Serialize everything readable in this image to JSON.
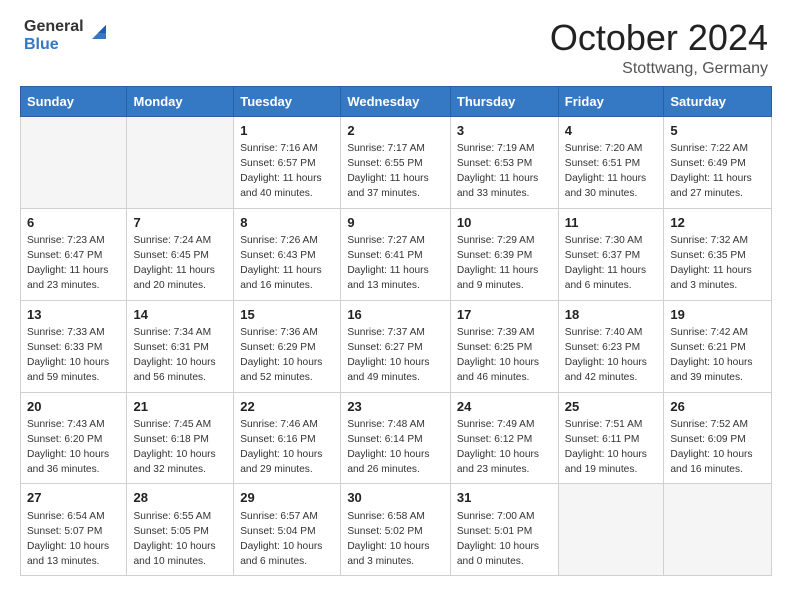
{
  "header": {
    "logo_line1": "General",
    "logo_line2": "Blue",
    "month": "October 2024",
    "location": "Stottwang, Germany"
  },
  "days_of_week": [
    "Sunday",
    "Monday",
    "Tuesday",
    "Wednesday",
    "Thursday",
    "Friday",
    "Saturday"
  ],
  "weeks": [
    [
      {
        "day": "",
        "detail": ""
      },
      {
        "day": "",
        "detail": ""
      },
      {
        "day": "1",
        "detail": "Sunrise: 7:16 AM\nSunset: 6:57 PM\nDaylight: 11 hours\nand 40 minutes."
      },
      {
        "day": "2",
        "detail": "Sunrise: 7:17 AM\nSunset: 6:55 PM\nDaylight: 11 hours\nand 37 minutes."
      },
      {
        "day": "3",
        "detail": "Sunrise: 7:19 AM\nSunset: 6:53 PM\nDaylight: 11 hours\nand 33 minutes."
      },
      {
        "day": "4",
        "detail": "Sunrise: 7:20 AM\nSunset: 6:51 PM\nDaylight: 11 hours\nand 30 minutes."
      },
      {
        "day": "5",
        "detail": "Sunrise: 7:22 AM\nSunset: 6:49 PM\nDaylight: 11 hours\nand 27 minutes."
      }
    ],
    [
      {
        "day": "6",
        "detail": "Sunrise: 7:23 AM\nSunset: 6:47 PM\nDaylight: 11 hours\nand 23 minutes."
      },
      {
        "day": "7",
        "detail": "Sunrise: 7:24 AM\nSunset: 6:45 PM\nDaylight: 11 hours\nand 20 minutes."
      },
      {
        "day": "8",
        "detail": "Sunrise: 7:26 AM\nSunset: 6:43 PM\nDaylight: 11 hours\nand 16 minutes."
      },
      {
        "day": "9",
        "detail": "Sunrise: 7:27 AM\nSunset: 6:41 PM\nDaylight: 11 hours\nand 13 minutes."
      },
      {
        "day": "10",
        "detail": "Sunrise: 7:29 AM\nSunset: 6:39 PM\nDaylight: 11 hours\nand 9 minutes."
      },
      {
        "day": "11",
        "detail": "Sunrise: 7:30 AM\nSunset: 6:37 PM\nDaylight: 11 hours\nand 6 minutes."
      },
      {
        "day": "12",
        "detail": "Sunrise: 7:32 AM\nSunset: 6:35 PM\nDaylight: 11 hours\nand 3 minutes."
      }
    ],
    [
      {
        "day": "13",
        "detail": "Sunrise: 7:33 AM\nSunset: 6:33 PM\nDaylight: 10 hours\nand 59 minutes."
      },
      {
        "day": "14",
        "detail": "Sunrise: 7:34 AM\nSunset: 6:31 PM\nDaylight: 10 hours\nand 56 minutes."
      },
      {
        "day": "15",
        "detail": "Sunrise: 7:36 AM\nSunset: 6:29 PM\nDaylight: 10 hours\nand 52 minutes."
      },
      {
        "day": "16",
        "detail": "Sunrise: 7:37 AM\nSunset: 6:27 PM\nDaylight: 10 hours\nand 49 minutes."
      },
      {
        "day": "17",
        "detail": "Sunrise: 7:39 AM\nSunset: 6:25 PM\nDaylight: 10 hours\nand 46 minutes."
      },
      {
        "day": "18",
        "detail": "Sunrise: 7:40 AM\nSunset: 6:23 PM\nDaylight: 10 hours\nand 42 minutes."
      },
      {
        "day": "19",
        "detail": "Sunrise: 7:42 AM\nSunset: 6:21 PM\nDaylight: 10 hours\nand 39 minutes."
      }
    ],
    [
      {
        "day": "20",
        "detail": "Sunrise: 7:43 AM\nSunset: 6:20 PM\nDaylight: 10 hours\nand 36 minutes."
      },
      {
        "day": "21",
        "detail": "Sunrise: 7:45 AM\nSunset: 6:18 PM\nDaylight: 10 hours\nand 32 minutes."
      },
      {
        "day": "22",
        "detail": "Sunrise: 7:46 AM\nSunset: 6:16 PM\nDaylight: 10 hours\nand 29 minutes."
      },
      {
        "day": "23",
        "detail": "Sunrise: 7:48 AM\nSunset: 6:14 PM\nDaylight: 10 hours\nand 26 minutes."
      },
      {
        "day": "24",
        "detail": "Sunrise: 7:49 AM\nSunset: 6:12 PM\nDaylight: 10 hours\nand 23 minutes."
      },
      {
        "day": "25",
        "detail": "Sunrise: 7:51 AM\nSunset: 6:11 PM\nDaylight: 10 hours\nand 19 minutes."
      },
      {
        "day": "26",
        "detail": "Sunrise: 7:52 AM\nSunset: 6:09 PM\nDaylight: 10 hours\nand 16 minutes."
      }
    ],
    [
      {
        "day": "27",
        "detail": "Sunrise: 6:54 AM\nSunset: 5:07 PM\nDaylight: 10 hours\nand 13 minutes."
      },
      {
        "day": "28",
        "detail": "Sunrise: 6:55 AM\nSunset: 5:05 PM\nDaylight: 10 hours\nand 10 minutes."
      },
      {
        "day": "29",
        "detail": "Sunrise: 6:57 AM\nSunset: 5:04 PM\nDaylight: 10 hours\nand 6 minutes."
      },
      {
        "day": "30",
        "detail": "Sunrise: 6:58 AM\nSunset: 5:02 PM\nDaylight: 10 hours\nand 3 minutes."
      },
      {
        "day": "31",
        "detail": "Sunrise: 7:00 AM\nSunset: 5:01 PM\nDaylight: 10 hours\nand 0 minutes."
      },
      {
        "day": "",
        "detail": ""
      },
      {
        "day": "",
        "detail": ""
      }
    ]
  ]
}
